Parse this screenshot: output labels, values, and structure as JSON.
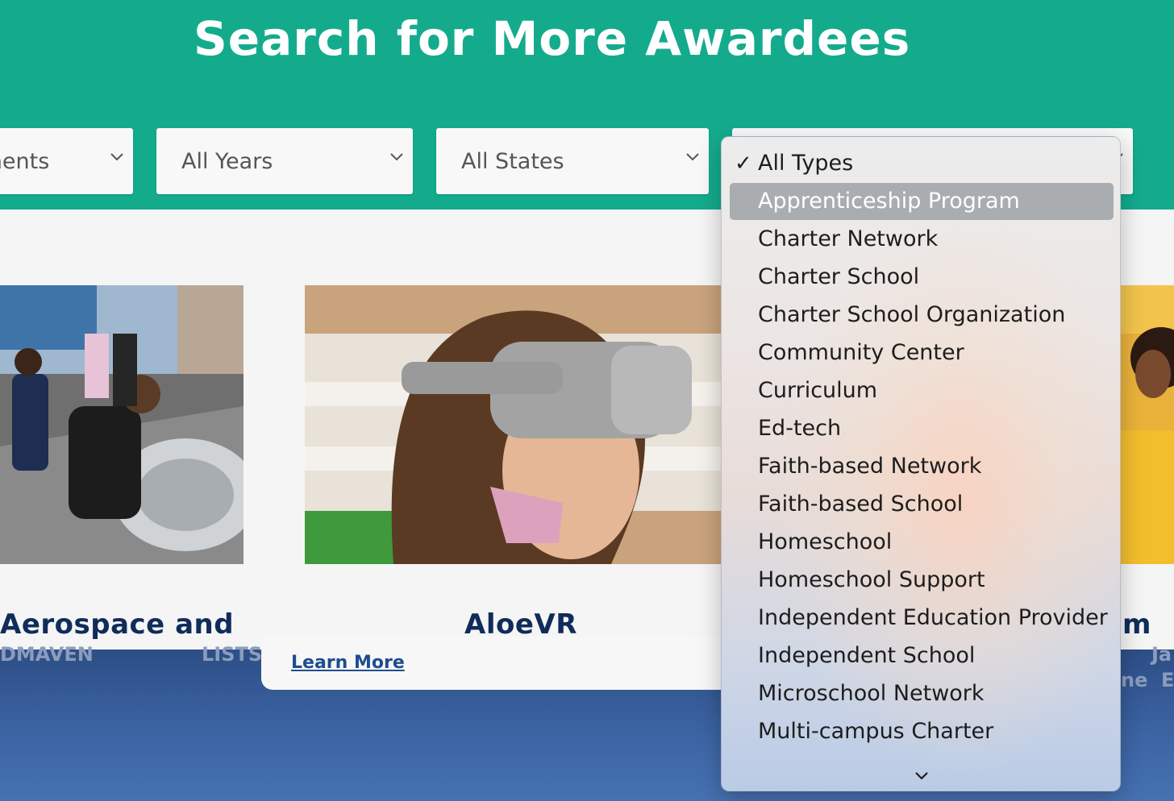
{
  "hero": {
    "title": "Search for More Awardees"
  },
  "filters": {
    "achievements": {
      "value": "ements"
    },
    "years": {
      "value": "All Years"
    },
    "states": {
      "value": "All States"
    },
    "types": {
      "value": "All Types"
    }
  },
  "cards": [
    {
      "title": "Aerospace and",
      "footer_text": "DMAVEN"
    },
    {
      "title": "AloeVR",
      "footer_text": "LISTS",
      "link": "Learn More"
    },
    {
      "title": "m",
      "footer_text_1": "Ja",
      "footer_text_2": "ne",
      "footer_text_3": "E"
    }
  ],
  "type_menu": {
    "selected": "All Types",
    "highlighted": "Apprenticeship Program",
    "items": [
      "All Types",
      "Apprenticeship Program",
      "Charter Network",
      "Charter School",
      "Charter School Organization",
      "Community Center",
      "Curriculum",
      "Ed-tech",
      "Faith-based Network",
      "Faith-based School",
      "Homeschool",
      "Homeschool Support",
      "Independent Education Provider",
      "Independent School",
      "Microschool Network",
      "Multi-campus Charter"
    ],
    "check_glyph": "✓",
    "more_icon": "chevron-down-icon"
  },
  "colors": {
    "hero_bg": "#14ab8d",
    "title_navy": "#0f2c5a",
    "link_blue": "#1f4d8f",
    "footer_blue": "#3d66a6",
    "menu_highlight": "#a9adb0"
  }
}
